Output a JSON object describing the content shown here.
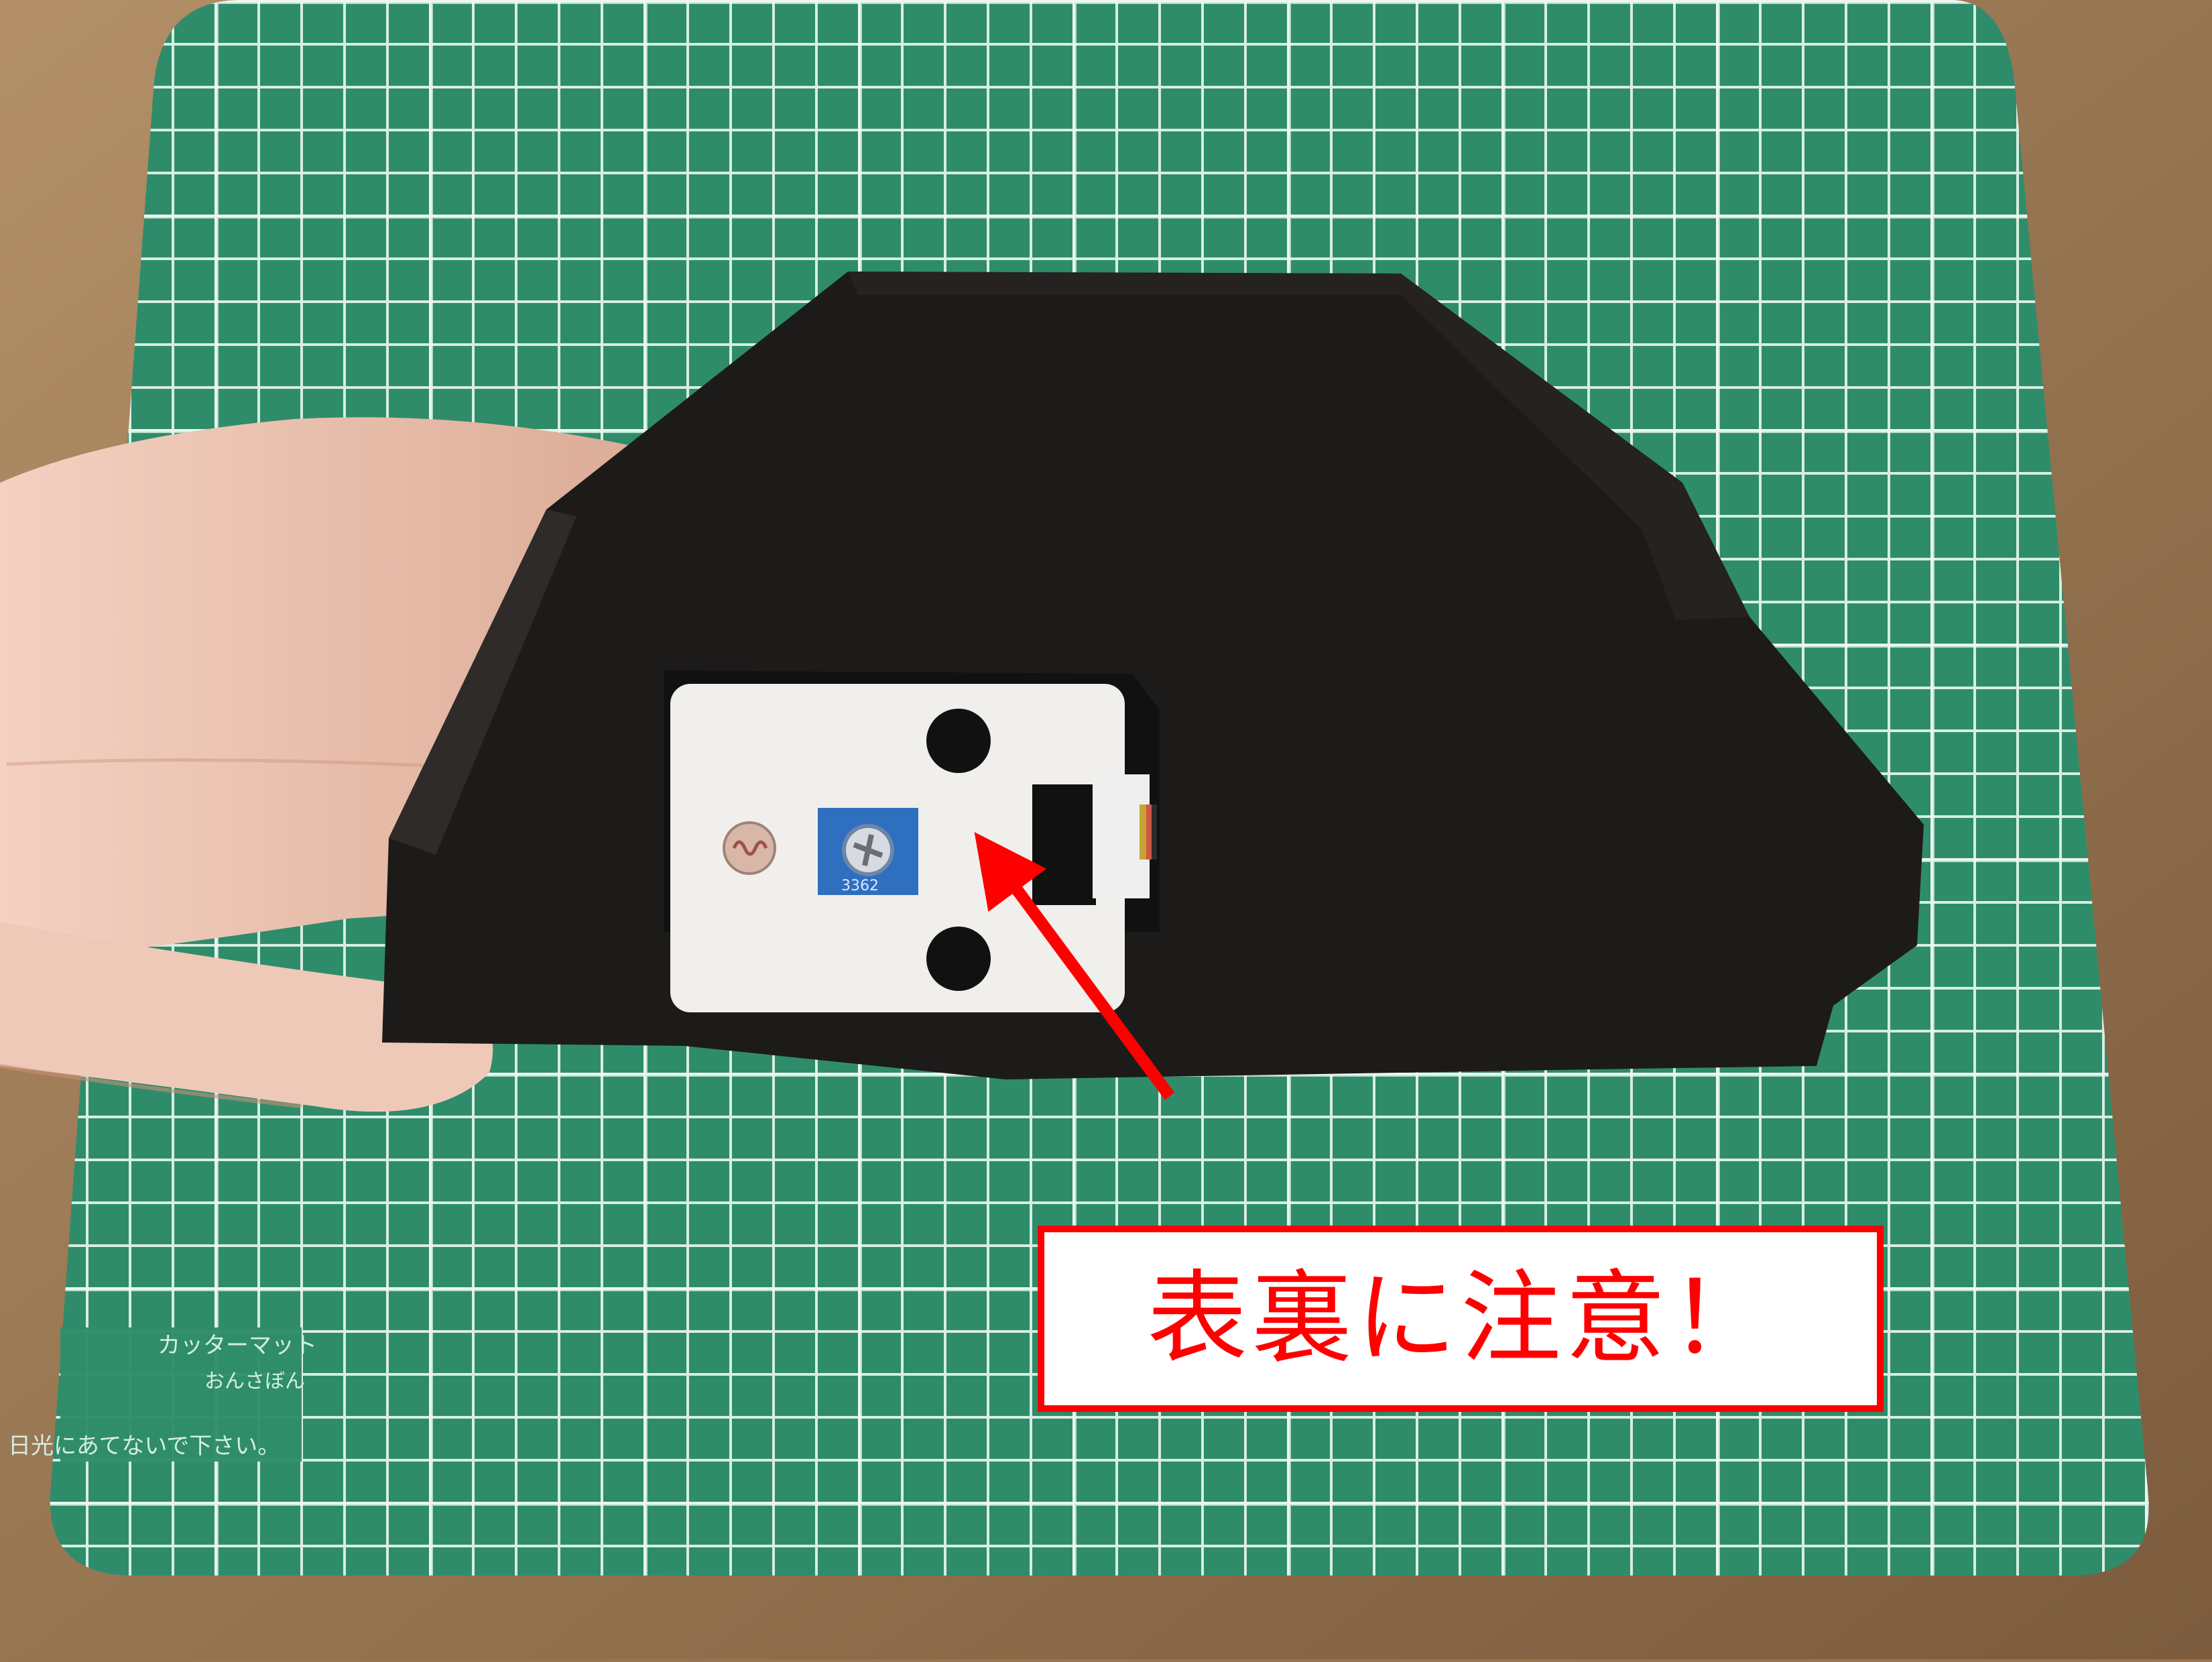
{
  "photo": {
    "mat_text_line_1": "カッターマット",
    "mat_text_line_2": "おんさぼん",
    "mat_text_line_3": "日光にあてないで下さい。",
    "pot_marking": "3362"
  },
  "callout": {
    "text": "表裏に注意！",
    "color": "#ff0000"
  },
  "colors": {
    "background_wood": "#9a7450",
    "mat_green": "#2f8c6a",
    "mat_lines": "#d8eee2",
    "case_black": "#1d1b1a",
    "module_white": "#f1efeb",
    "pot_blue": "#2f6fc0",
    "arrow_red": "#ff0000"
  }
}
